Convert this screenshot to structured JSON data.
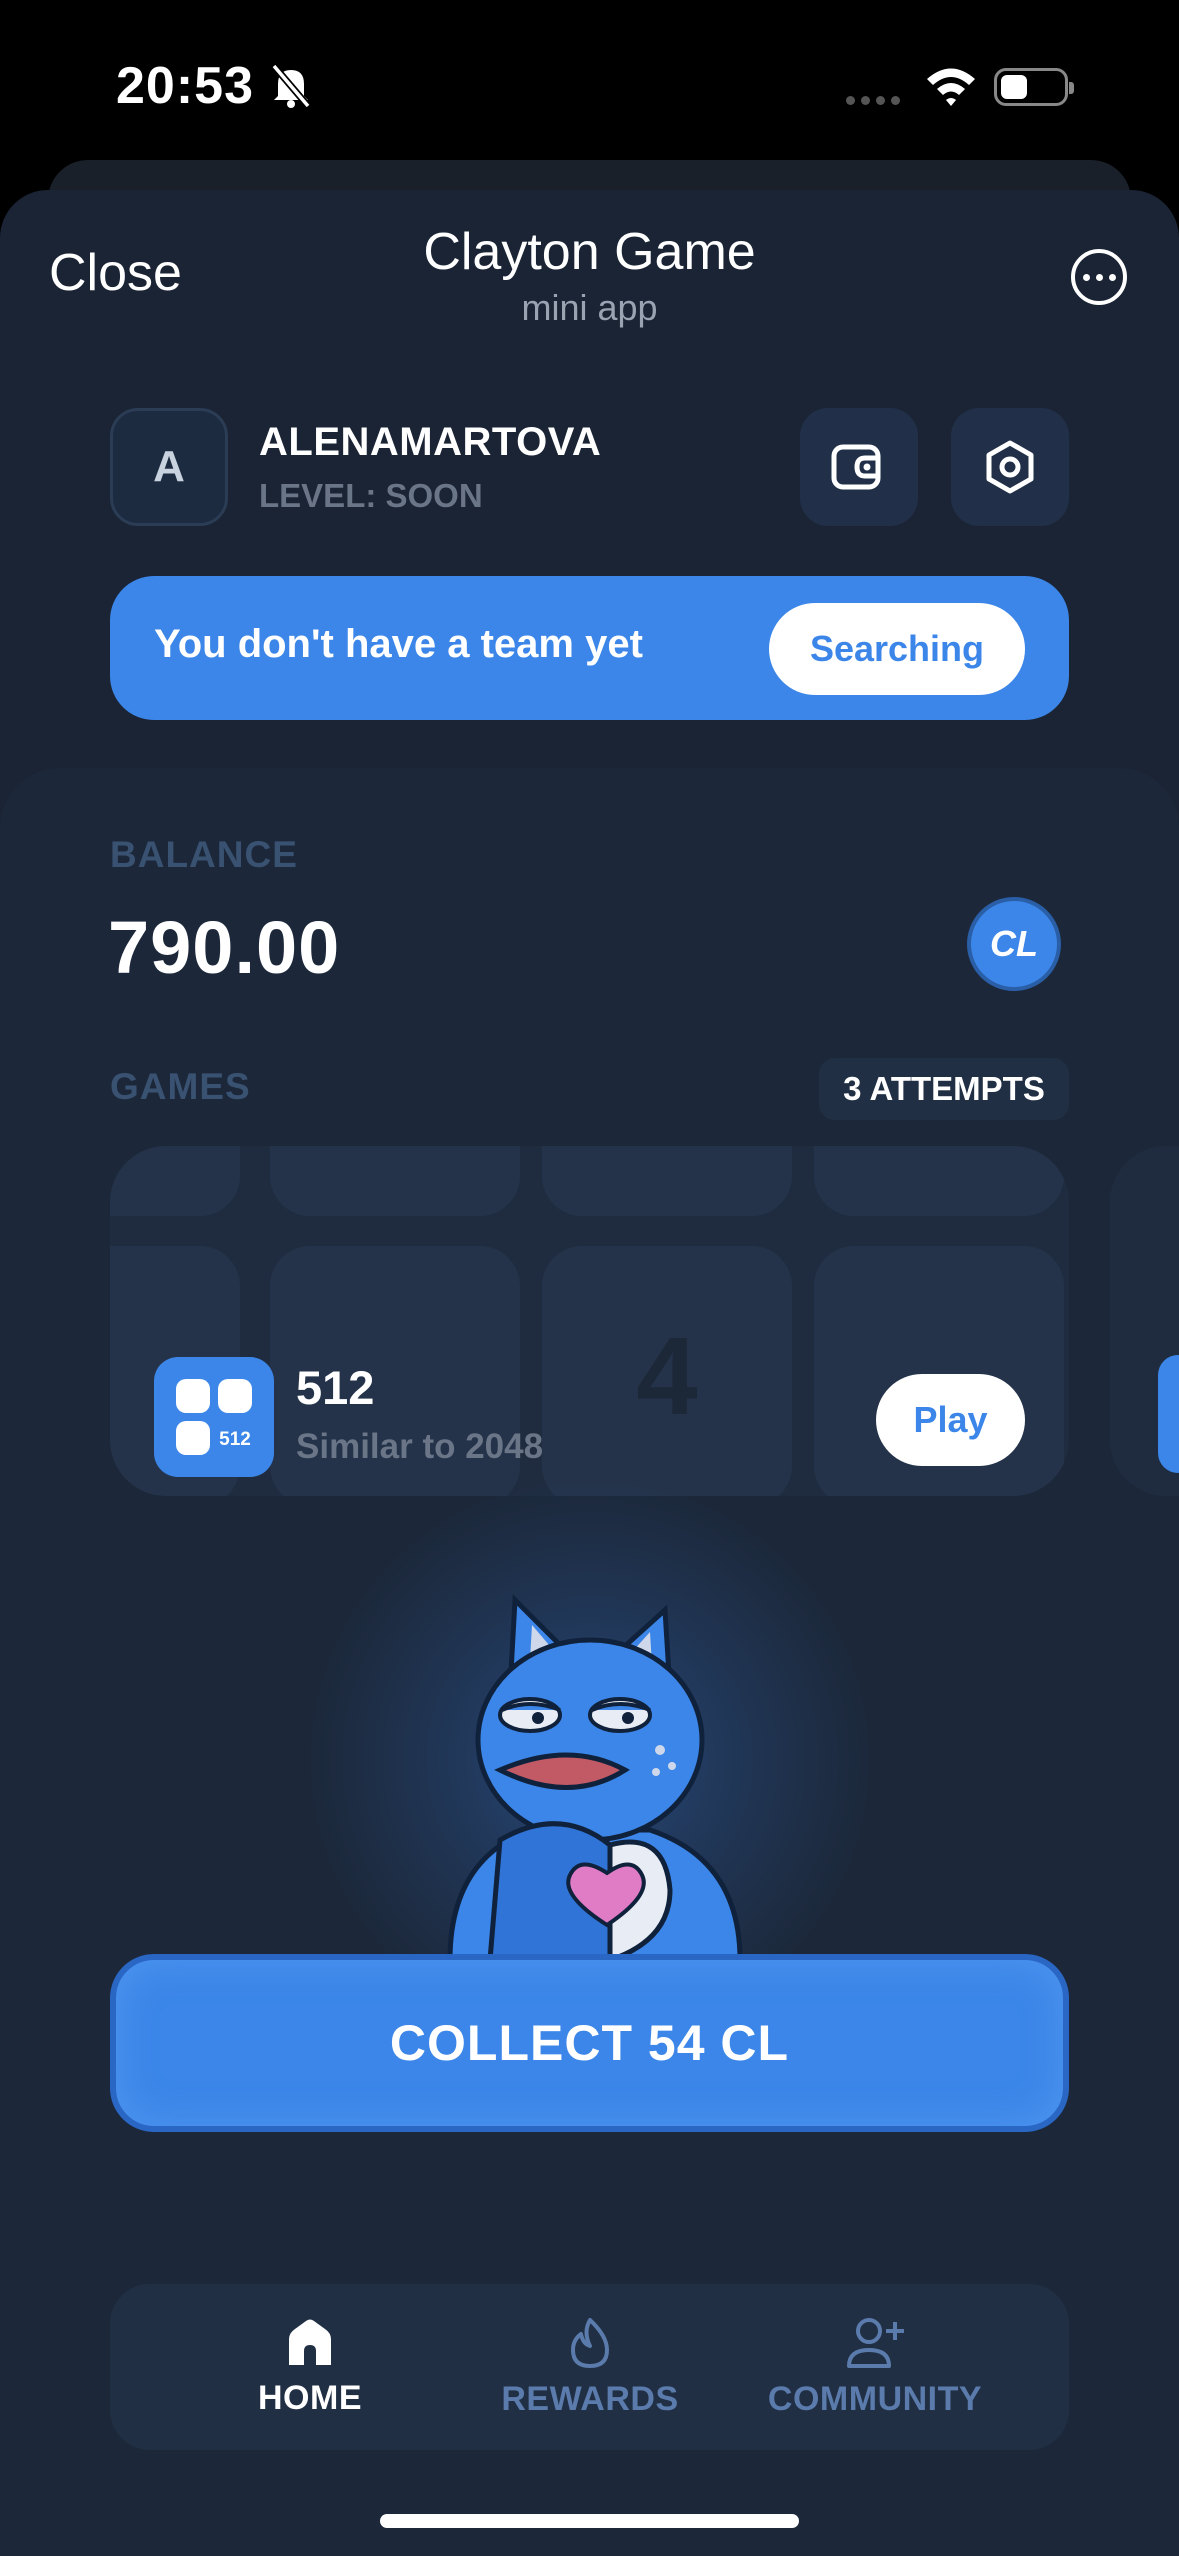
{
  "status_bar": {
    "time": "20:53"
  },
  "header": {
    "close_label": "Close",
    "title": "Clayton Game",
    "subtitle": "mini app"
  },
  "profile": {
    "avatar_letter": "A",
    "username": "ALENAMARTOVA",
    "level": "LEVEL: SOON"
  },
  "team": {
    "message": "You don't have a team yet",
    "button_label": "Searching"
  },
  "balance": {
    "label": "BALANCE",
    "value": "790.00",
    "coin_label": "CL"
  },
  "games": {
    "label": "GAMES",
    "attempts": "3 ATTEMPTS",
    "card": {
      "tile_number": "4",
      "icon_number": "512",
      "name": "512",
      "description": "Similar to 2048",
      "play_label": "Play"
    }
  },
  "collect": {
    "label": "COLLECT 54 CL"
  },
  "nav": {
    "items": [
      {
        "label": "HOME",
        "icon": "home-icon",
        "active": true
      },
      {
        "label": "REWARDS",
        "icon": "flame-icon",
        "active": false
      },
      {
        "label": "COMMUNITY",
        "icon": "add-user-icon",
        "active": false
      }
    ]
  },
  "colors": {
    "accent": "#3b86e8",
    "sheet": "#1a2434",
    "panel": "#1c283a",
    "muted_label": "#3a5272",
    "nav_inactive": "#5a7bab"
  }
}
